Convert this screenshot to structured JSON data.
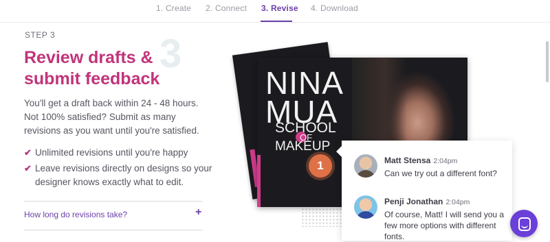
{
  "tabs": [
    {
      "label": "1. Create",
      "active": false
    },
    {
      "label": "2. Connect",
      "active": false
    },
    {
      "label": "3. Revise",
      "active": true
    },
    {
      "label": "4. Download",
      "active": false
    }
  ],
  "step": {
    "label": "STEP 3",
    "number": "3",
    "title_line1": "Review drafts &",
    "title_line2": "submit feedback",
    "body": "You'll get a draft back within 24 - 48 hours. Not 100% satisfied? Submit as many revisions as you want until you're satisfied.",
    "features": [
      "Unlimited revisions until you're happy",
      "Leave revisions directly on designs so your designer knows exactly what to edit."
    ],
    "faq_question": "How long do revisions take?",
    "faq_icon": "+"
  },
  "design": {
    "line1": "NINA",
    "line2": "MUA",
    "line3": "SCHOOL",
    "line4": "OF",
    "line5": "MAKEUP",
    "badge_number": "1"
  },
  "chat": {
    "messages": [
      {
        "name": "Matt Stensa",
        "time": "2:04pm",
        "text": "Can we try out a different font?"
      },
      {
        "name": "Penji Jonathan",
        "time": "2:04pm",
        "text": "Of course, Matt! I will send you a few more options with different fonts."
      }
    ]
  },
  "colors": {
    "accent": "#6b3fa8",
    "headline": "#c1347a",
    "badge": "#df7146",
    "fab": "#6b3fd9"
  },
  "icons": {
    "check": "checkmark-icon",
    "plus": "plus-icon",
    "chat": "chat-launcher-icon"
  }
}
